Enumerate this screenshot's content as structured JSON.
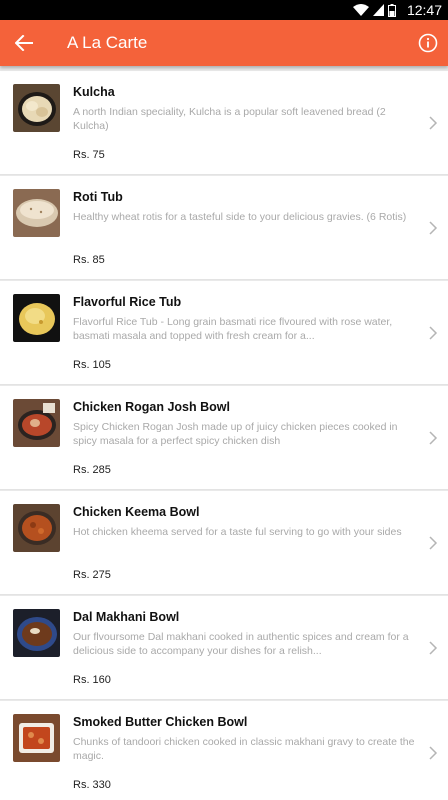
{
  "status_bar": {
    "time": "12:47"
  },
  "app_bar": {
    "title": "A La Carte"
  },
  "items": [
    {
      "name": "Kulcha",
      "description": "A north Indian speciality, Kulcha is a popular soft leavened bread (2 Kulcha)",
      "price": "Rs. 75"
    },
    {
      "name": "Roti Tub",
      "description": "Healthy wheat rotis for a tasteful side to your delicious gravies. (6 Rotis)",
      "price": "Rs. 85"
    },
    {
      "name": "Flavorful Rice Tub",
      "description": "Flavorful Rice Tub - Long grain basmati rice flvoured with rose water, basmati masala and topped with fresh cream for a...",
      "price": "Rs. 105"
    },
    {
      "name": "Chicken Rogan Josh Bowl",
      "description": "Spicy Chicken Rogan Josh made up of juicy chicken pieces cooked in spicy masala for a perfect spicy chicken dish",
      "price": "Rs. 285"
    },
    {
      "name": "Chicken Keema Bowl",
      "description": "Hot chicken kheema served for a taste ful serving to go with your sides",
      "price": "Rs. 275"
    },
    {
      "name": "Dal Makhani Bowl",
      "description": "Our flvoursome Dal makhani cooked in authentic spices and cream for a delicious side to accompany your dishes for a relish...",
      "price": "Rs. 160"
    },
    {
      "name": "Smoked Butter Chicken Bowl",
      "description": "Chunks of tandoori chicken cooked in classic makhani gravy to create the magic.",
      "price": "Rs. 330"
    }
  ]
}
